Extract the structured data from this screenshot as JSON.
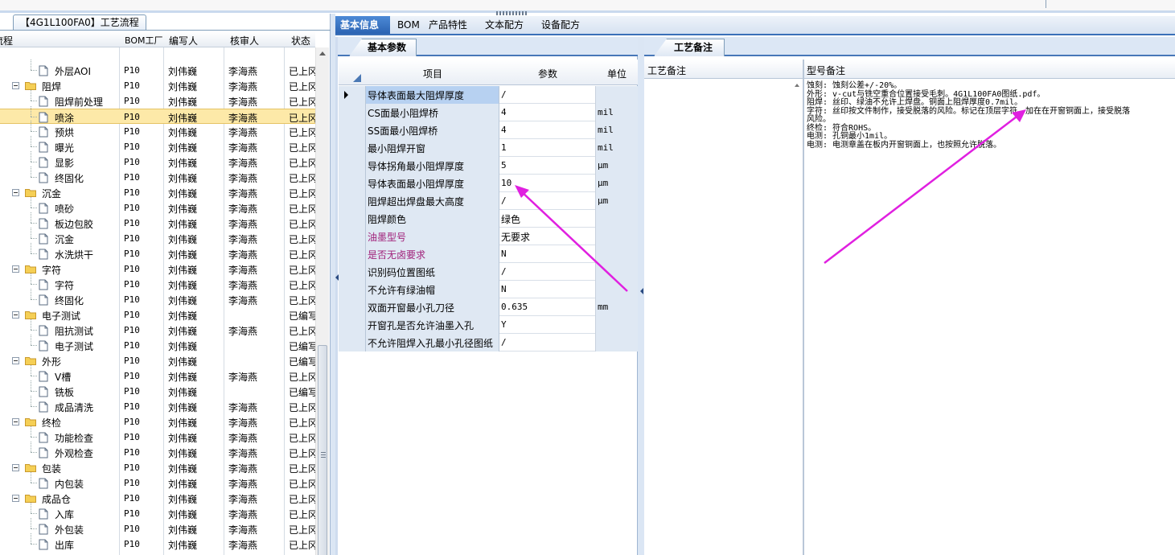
{
  "left_panel": {
    "tab_title": "【4G1L100FA0】工艺流程",
    "columns": [
      "流程",
      "BOM工厂",
      "编写人",
      "核审人",
      "状态"
    ],
    "rows": [
      {
        "name": "外层AOI",
        "level": 2,
        "factory": "P10",
        "author": "刘伟巍",
        "reviewer": "李海燕",
        "status": "已上冈"
      },
      {
        "name": "阻焊",
        "level": 1,
        "factory": "P10",
        "author": "刘伟巍",
        "reviewer": "李海燕",
        "status": "已上冈"
      },
      {
        "name": "阻焊前处理",
        "level": 2,
        "factory": "P10",
        "author": "刘伟巍",
        "reviewer": "李海燕",
        "status": "已上冈"
      },
      {
        "name": "喷涂",
        "level": 2,
        "factory": "P10",
        "author": "刘伟巍",
        "reviewer": "李海燕",
        "status": "已上冈",
        "selected": true
      },
      {
        "name": "预烘",
        "level": 2,
        "factory": "P10",
        "author": "刘伟巍",
        "reviewer": "李海燕",
        "status": "已上冈"
      },
      {
        "name": "曝光",
        "level": 2,
        "factory": "P10",
        "author": "刘伟巍",
        "reviewer": "李海燕",
        "status": "已上冈"
      },
      {
        "name": "显影",
        "level": 2,
        "factory": "P10",
        "author": "刘伟巍",
        "reviewer": "李海燕",
        "status": "已上冈"
      },
      {
        "name": "终固化",
        "level": 2,
        "factory": "P10",
        "author": "刘伟巍",
        "reviewer": "李海燕",
        "status": "已上冈"
      },
      {
        "name": "沉金",
        "level": 1,
        "factory": "P10",
        "author": "刘伟巍",
        "reviewer": "李海燕",
        "status": "已上冈"
      },
      {
        "name": "喷砂",
        "level": 2,
        "factory": "P10",
        "author": "刘伟巍",
        "reviewer": "李海燕",
        "status": "已上冈"
      },
      {
        "name": "板边包胶",
        "level": 2,
        "factory": "P10",
        "author": "刘伟巍",
        "reviewer": "李海燕",
        "status": "已上冈"
      },
      {
        "name": "沉金",
        "level": 2,
        "factory": "P10",
        "author": "刘伟巍",
        "reviewer": "李海燕",
        "status": "已上冈"
      },
      {
        "name": "水洗烘干",
        "level": 2,
        "factory": "P10",
        "author": "刘伟巍",
        "reviewer": "李海燕",
        "status": "已上冈"
      },
      {
        "name": "字符",
        "level": 1,
        "factory": "P10",
        "author": "刘伟巍",
        "reviewer": "李海燕",
        "status": "已上冈"
      },
      {
        "name": "字符",
        "level": 2,
        "factory": "P10",
        "author": "刘伟巍",
        "reviewer": "李海燕",
        "status": "已上冈"
      },
      {
        "name": "终固化",
        "level": 2,
        "factory": "P10",
        "author": "刘伟巍",
        "reviewer": "李海燕",
        "status": "已上冈"
      },
      {
        "name": "电子测试",
        "level": 1,
        "factory": "P10",
        "author": "刘伟巍",
        "reviewer": "",
        "status": "已编写"
      },
      {
        "name": "阻抗测试",
        "level": 2,
        "factory": "P10",
        "author": "刘伟巍",
        "reviewer": "李海燕",
        "status": "已上冈"
      },
      {
        "name": "电子测试",
        "level": 2,
        "factory": "P10",
        "author": "刘伟巍",
        "reviewer": "",
        "status": "已编写"
      },
      {
        "name": "外形",
        "level": 1,
        "factory": "P10",
        "author": "刘伟巍",
        "reviewer": "",
        "status": "已编写"
      },
      {
        "name": "V槽",
        "level": 2,
        "factory": "P10",
        "author": "刘伟巍",
        "reviewer": "李海燕",
        "status": "已上冈"
      },
      {
        "name": "铣板",
        "level": 2,
        "factory": "P10",
        "author": "刘伟巍",
        "reviewer": "",
        "status": "已编写"
      },
      {
        "name": "成品清洗",
        "level": 2,
        "factory": "P10",
        "author": "刘伟巍",
        "reviewer": "李海燕",
        "status": "已上冈"
      },
      {
        "name": "终检",
        "level": 1,
        "factory": "P10",
        "author": "刘伟巍",
        "reviewer": "李海燕",
        "status": "已上冈"
      },
      {
        "name": "功能检查",
        "level": 2,
        "factory": "P10",
        "author": "刘伟巍",
        "reviewer": "李海燕",
        "status": "已上冈"
      },
      {
        "name": "外观检查",
        "level": 2,
        "factory": "P10",
        "author": "刘伟巍",
        "reviewer": "李海燕",
        "status": "已上冈"
      },
      {
        "name": "包装",
        "level": 1,
        "factory": "P10",
        "author": "刘伟巍",
        "reviewer": "李海燕",
        "status": "已上冈"
      },
      {
        "name": "内包装",
        "level": 2,
        "factory": "P10",
        "author": "刘伟巍",
        "reviewer": "李海燕",
        "status": "已上冈"
      },
      {
        "name": "成品仓",
        "level": 1,
        "factory": "P10",
        "author": "刘伟巍",
        "reviewer": "李海燕",
        "status": "已上冈"
      },
      {
        "name": "入库",
        "level": 2,
        "factory": "P10",
        "author": "刘伟巍",
        "reviewer": "李海燕",
        "status": "已上冈"
      },
      {
        "name": "外包装",
        "level": 2,
        "factory": "P10",
        "author": "刘伟巍",
        "reviewer": "李海燕",
        "status": "已上冈"
      },
      {
        "name": "出库",
        "level": 2,
        "factory": "P10",
        "author": "刘伟巍",
        "reviewer": "李海燕",
        "status": "已上冈"
      }
    ]
  },
  "tabs": [
    {
      "label": "基本信息",
      "active": true
    },
    {
      "label": "BOM",
      "active": false
    },
    {
      "label": "产品特性",
      "active": false
    },
    {
      "label": "文本配方",
      "active": false
    },
    {
      "label": "设备配方",
      "active": false
    }
  ],
  "basic_params": {
    "tab_title": "基本参数",
    "columns": {
      "item": "项目",
      "param": "参数",
      "unit": "单位"
    },
    "rows": [
      {
        "item": "导体表面最大阻焊厚度",
        "param": "/",
        "unit": ""
      },
      {
        "item": "CS面最小阻焊桥",
        "param": "4",
        "unit": "mil"
      },
      {
        "item": "SS面最小阻焊桥",
        "param": "4",
        "unit": "mil"
      },
      {
        "item": "最小阻焊开窗",
        "param": "1",
        "unit": "mil"
      },
      {
        "item": "导体拐角最小阻焊厚度",
        "param": "5",
        "unit": "μm"
      },
      {
        "item": "导体表面最小阻焊厚度",
        "param": "10",
        "unit": "μm"
      },
      {
        "item": "阻焊超出焊盘最大高度",
        "param": "/",
        "unit": "μm"
      },
      {
        "item": "阻焊颜色",
        "param": "绿色",
        "unit": ""
      },
      {
        "item": "油墨型号",
        "param": "无要求",
        "unit": "",
        "highlight": true
      },
      {
        "item": "是否无卤要求",
        "param": "N",
        "unit": "",
        "highlight": true
      },
      {
        "item": "识别码位置图纸",
        "param": "/",
        "unit": ""
      },
      {
        "item": "不允许有绿油帽",
        "param": "N",
        "unit": ""
      },
      {
        "item": "双面开窗最小孔刀径",
        "param": "0.635",
        "unit": "mm"
      },
      {
        "item": "开窗孔是否允许油墨入孔",
        "param": "Y",
        "unit": ""
      },
      {
        "item": "不允许阻焊入孔最小孔径图纸",
        "param": "/",
        "unit": ""
      }
    ]
  },
  "process_notes": {
    "tab_title": "工艺备注",
    "col_process": "工艺备注",
    "col_model": "型号备注",
    "text": "蚀刻: 蚀刻公差+/-20%。\n外形: v-cut与铣空重合位置接受毛刺。4G1L100FA0图纸.pdf。\n阻焊: 丝印、绿油不允许上焊盘。铜面上阻焊厚度0.7mil。\n字符: 丝印按文件制作，接受脱落的风险。标记在顶层字符，加在在开窗铜面上，接受脱落\n风险。\n终检: 符合ROHS。\n电测: 孔铜最小1mil。\n电测: 电测章盖在板内开窗铜面上，也按照允许脱落。"
  },
  "colors": {
    "accent_tab": "#2b63b2",
    "selected_row": "#fde9a8",
    "highlight_text": "#a0207a",
    "annotation_arrow": "#e020e0"
  }
}
